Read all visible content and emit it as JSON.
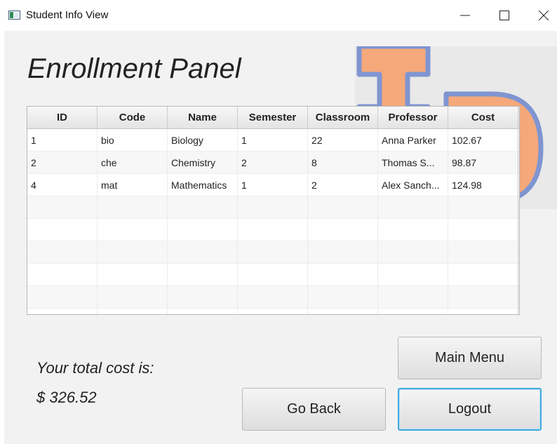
{
  "window": {
    "title": "Student Info View"
  },
  "panel": {
    "title": "Enrollment Panel"
  },
  "table": {
    "columns": [
      "ID",
      "Code",
      "Name",
      "Semester",
      "Classroom",
      "Professor",
      "Cost"
    ],
    "rows": [
      [
        "1",
        "bio",
        "Biology",
        "1",
        "22",
        "Anna Parker",
        "102.67"
      ],
      [
        "2",
        "che",
        "Chemistry",
        "2",
        "8",
        "Thomas S...",
        "98.87"
      ],
      [
        "4",
        "mat",
        "Mathematics",
        "1",
        "2",
        "Alex Sanch...",
        "124.98"
      ]
    ]
  },
  "summary": {
    "total_label": "Your total cost is:",
    "total_value": "$ 326.52"
  },
  "buttons": {
    "main_menu": "Main Menu",
    "go_back": "Go Back",
    "logout": "Logout"
  },
  "colors": {
    "logo_fill": "#f5a87a",
    "logo_stroke": "#7f95d1"
  },
  "icons": {
    "app": "window-app-icon",
    "minimize": "minimize-icon",
    "maximize": "maximize-icon",
    "close": "close-icon"
  }
}
